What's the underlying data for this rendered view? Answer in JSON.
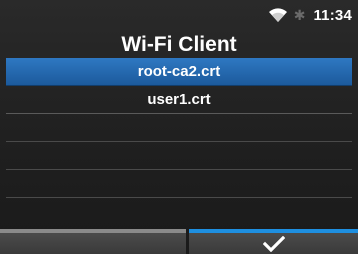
{
  "status": {
    "wifi_icon": "wifi-icon",
    "bluetooth_icon": "bluetooth-icon",
    "time": "11:34"
  },
  "header": {
    "title": "Wi-Fi Client"
  },
  "list": {
    "items": [
      {
        "label": "root-ca2.crt",
        "selected": true
      },
      {
        "label": "user1.crt",
        "selected": false
      }
    ]
  },
  "softkeys": {
    "left": {
      "icon": "none"
    },
    "right": {
      "icon": "checkmark-icon"
    }
  },
  "colors": {
    "selection": "#2a6fb5",
    "accent": "#1e8fe0",
    "background": "#222222"
  }
}
